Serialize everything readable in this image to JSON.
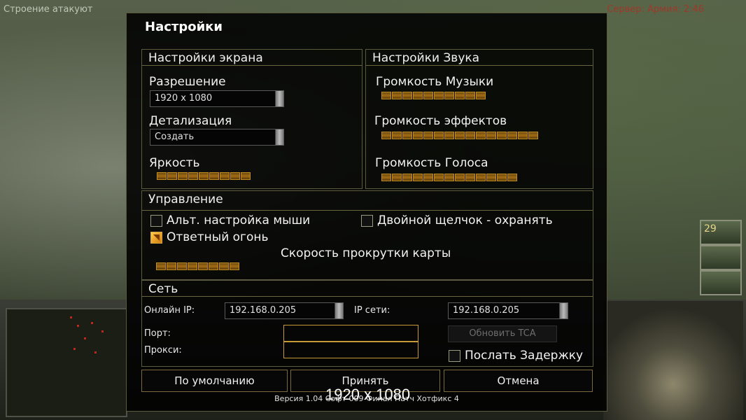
{
  "hud": {
    "top_left_text": "Строение атакуют",
    "top_right_text": "Сервер: Армия: 2:46",
    "side_count": "29"
  },
  "dialog": {
    "title": "Настройки",
    "display": {
      "header": "Настройки экрана",
      "resolution_label": "Разрешение",
      "resolution_value": "1920 x 1080",
      "detail_label": "Детализация",
      "detail_value": "Создать",
      "brightness_label": "Яркость",
      "brightness_level": 9
    },
    "sound": {
      "header": "Настройки Звука",
      "music_label": "Громкость Музыки",
      "music_level": 10,
      "effects_label": "Громкость эффектов",
      "effects_level": 15,
      "voice_label": "Громкость Голоса",
      "voice_level": 13
    },
    "controls": {
      "header": "Управление",
      "alt_mouse_label": "Альт. настройка мыши",
      "alt_mouse_checked": false,
      "double_click_label": "Двойной щелчок - охранять",
      "double_click_checked": false,
      "return_fire_label": "Ответный огонь",
      "return_fire_checked": true,
      "scroll_speed_label": "Скорость прокрутки карты",
      "scroll_speed_level": 8
    },
    "network": {
      "header": "Сеть",
      "online_ip_label": "Онлайн IP:",
      "online_ip_value": "192.168.0.205",
      "lan_ip_label": "IP сети:",
      "lan_ip_value": "192.168.0.205",
      "port_label": "Порт:",
      "port_value": "",
      "proxy_label": "Прокси:",
      "proxy_value": "",
      "update_button": "Обновить TCA",
      "send_delay_label": "Послать Задержку",
      "send_delay_checked": false
    },
    "buttons": {
      "default": "По умолчанию",
      "accept": "Принять",
      "cancel": "Отмена"
    },
    "version": "Версия 1.04 Софт 009 Финал Патч Хотфикс 4",
    "overlay_resolution": "1920 x 1080"
  },
  "colors": {
    "accent": "#c69a35",
    "slider_fill": "#a36c14",
    "dialog_bg": "#000000"
  }
}
